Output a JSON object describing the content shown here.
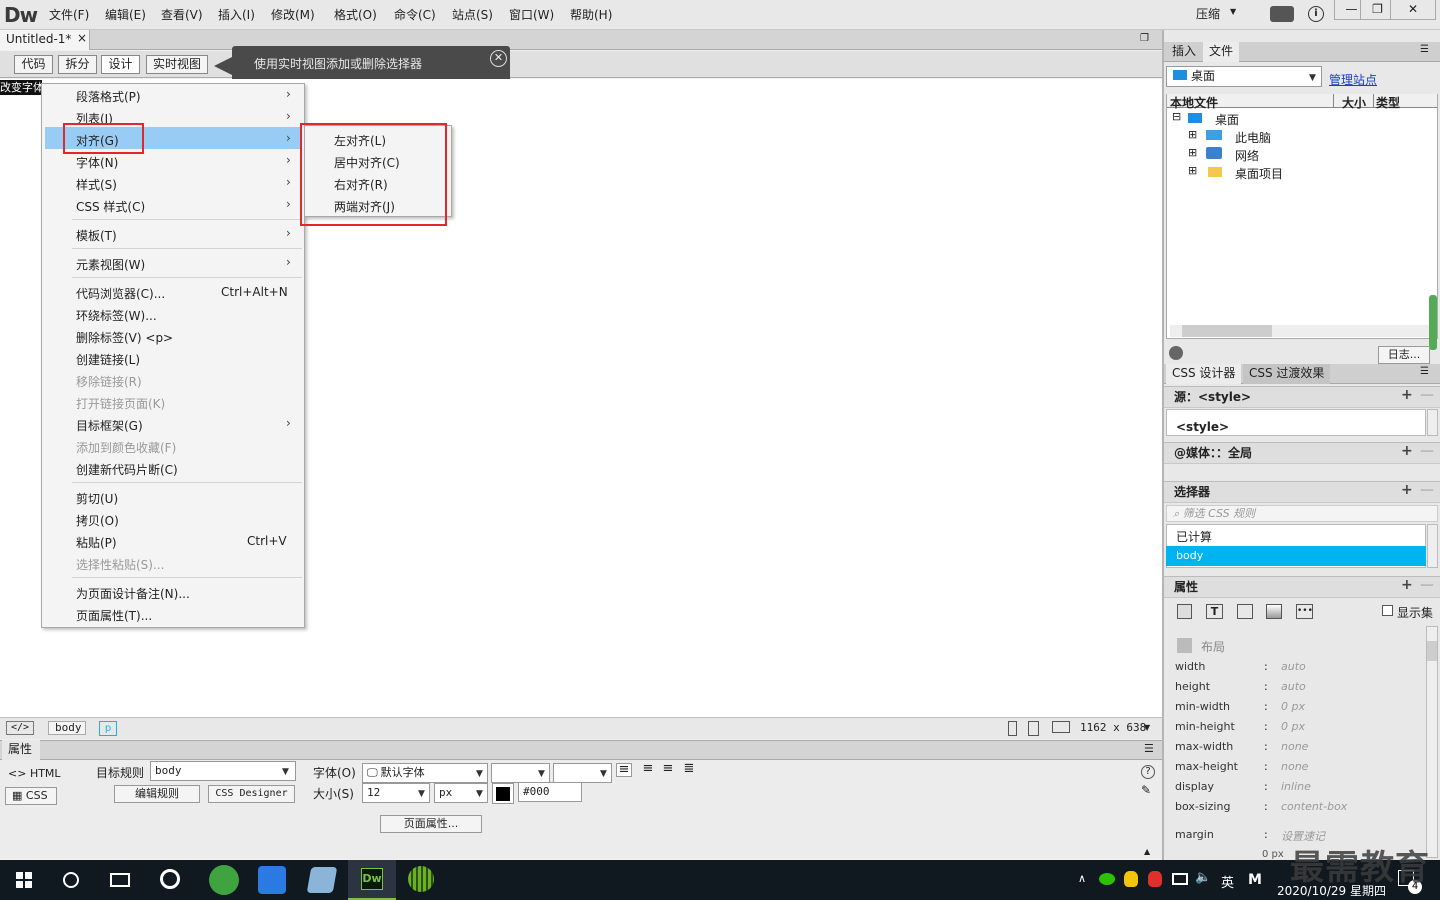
{
  "app": {
    "logo": "Dw",
    "menus": [
      "文件(F)",
      "编辑(E)",
      "查看(V)",
      "插入(I)",
      "修改(M)",
      "格式(O)",
      "命令(C)",
      "站点(S)",
      "窗口(W)",
      "帮助(H)"
    ],
    "compact_label": "压缩"
  },
  "document": {
    "tab_title": "Untitled-1*",
    "close_glyph": "×",
    "view_buttons": [
      "代码",
      "拆分",
      "设计",
      "实时视图"
    ],
    "active_view": "设计",
    "tooltip": "使用实时视图添加或删除选择器",
    "tooltip_close": "✕",
    "canvas_text": "改变字体"
  },
  "context_menu": {
    "items": [
      {
        "label": "段落格式(P)",
        "arrow": "›"
      },
      {
        "label": "列表(I)",
        "arrow": "›"
      },
      {
        "label": "对齐(G)",
        "arrow": "›"
      },
      {
        "label": "字体(N)",
        "arrow": "›"
      },
      {
        "label": "样式(S)",
        "arrow": "›"
      },
      {
        "label": "CSS 样式(C)",
        "arrow": "›"
      },
      {
        "label": "模板(T)",
        "arrow": "›"
      },
      {
        "label": "元素视图(W)",
        "arrow": "›"
      },
      {
        "label": "代码浏览器(C)...",
        "shortcut": "Ctrl+Alt+N"
      },
      {
        "label": "环绕标签(W)..."
      },
      {
        "label": "删除标签(V) <p>"
      },
      {
        "label": "创建链接(L)"
      },
      {
        "label": "移除链接(R)"
      },
      {
        "label": "打开链接页面(K)"
      },
      {
        "label": "目标框架(G)",
        "arrow": "›"
      },
      {
        "label": "添加到颜色收藏(F)"
      },
      {
        "label": "创建新代码片断(C)"
      },
      {
        "label": "剪切(U)"
      },
      {
        "label": "拷贝(O)"
      },
      {
        "label": "粘贴(P)",
        "shortcut": "Ctrl+V"
      },
      {
        "label": "选择性粘贴(S)..."
      },
      {
        "label": "为页面设计备注(N)..."
      },
      {
        "label": "页面属性(T)..."
      }
    ],
    "submenu": [
      "左对齐(L)",
      "居中对齐(C)",
      "右对齐(R)",
      "两端对齐(J)"
    ]
  },
  "status_bar": {
    "code_icon": "</>",
    "tag_body": "body",
    "tag_p": "p",
    "dimensions": "1162 x 638"
  },
  "properties": {
    "tab": "属性",
    "html_btn": "HTML",
    "css_btn": "CSS",
    "target_rule_label": "目标规则",
    "target_rule_value": "body",
    "edit_rule": "编辑规则",
    "css_designer": "CSS Designer",
    "font_label": "字体(O)",
    "font_value": "默认字体",
    "size_label": "大小(S)",
    "size_value": "12",
    "size_unit": "px",
    "color_value": "#000",
    "page_props": "页面属性..."
  },
  "files_panel": {
    "tabs": [
      "插入",
      "文件"
    ],
    "location": "桌面",
    "manage_site": "管理站点",
    "columns": [
      "本地文件",
      "大小",
      "类型"
    ],
    "tree": [
      {
        "label": "桌面",
        "toggle": "⊟"
      },
      {
        "label": "此电脑",
        "toggle": "⊞"
      },
      {
        "label": "网络",
        "toggle": "⊞"
      },
      {
        "label": "桌面项目",
        "toggle": "⊞"
      }
    ],
    "log_btn": "日志..."
  },
  "css_panel": {
    "tabs": [
      "CSS 设计器",
      "CSS 过渡效果"
    ],
    "source_label": "源：<style>",
    "source_item": "<style>",
    "media_label": "@媒体：：全局",
    "selector_label": "选择器",
    "filter_placeholder": "筛选 CSS 规则",
    "computed": "已计算",
    "selected": "body",
    "properties_label": "属性",
    "show_set": "显示集",
    "layout_label": "布局",
    "props": [
      {
        "name": "width",
        "value": "auto"
      },
      {
        "name": "height",
        "value": "auto"
      },
      {
        "name": "min-width",
        "value": "0 px"
      },
      {
        "name": "min-height",
        "value": "0 px"
      },
      {
        "name": "max-width",
        "value": "none"
      },
      {
        "name": "max-height",
        "value": "none"
      },
      {
        "name": "display",
        "value": "inline"
      },
      {
        "name": "box-sizing",
        "value": "content-box"
      }
    ],
    "margin_label": "margin",
    "margin_value": "设置速记",
    "margin_px": "0 px"
  },
  "taskbar": {
    "ime": "英",
    "time": "2020/10/29 星期四",
    "notif_count": "4"
  },
  "watermark": "最需教育",
  "colors": {
    "highlight": "#99ccf4",
    "selected_row": "#00b4f0",
    "red_box": "#e0282d",
    "dw_green": "#7ac143"
  }
}
